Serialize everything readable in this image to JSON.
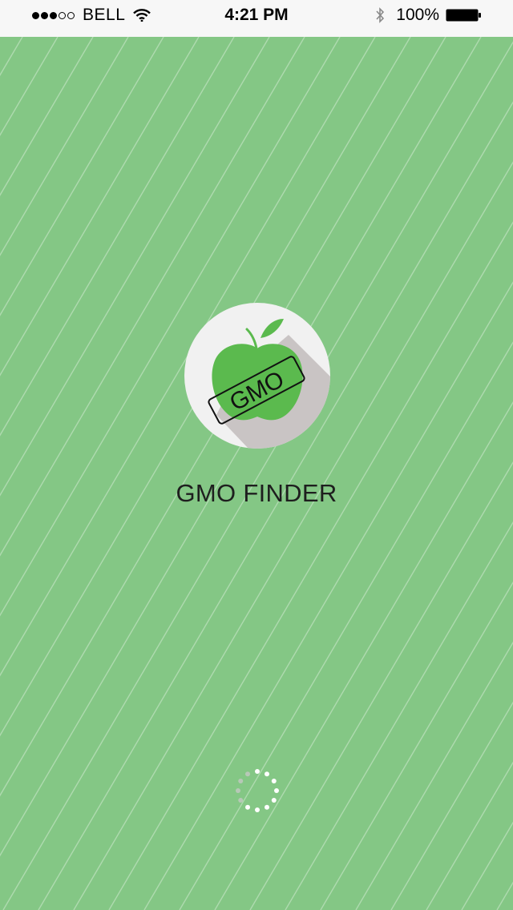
{
  "status_bar": {
    "carrier": "BELL",
    "time": "4:21 PM",
    "battery": "100%",
    "signal_bars_filled": 3,
    "signal_bars_total": 5
  },
  "app": {
    "title": "GMO FINDER",
    "logo_label": "GMO",
    "background_color": "#84c785",
    "apple_color": "#5bba4e",
    "logo_circle_color": "#f1f1f1"
  },
  "icons": {
    "wifi": "wifi-icon",
    "bluetooth": "bluetooth-icon",
    "battery": "battery-icon",
    "logo": "apple-gmo-logo-icon",
    "loading": "loading-spinner-icon"
  }
}
